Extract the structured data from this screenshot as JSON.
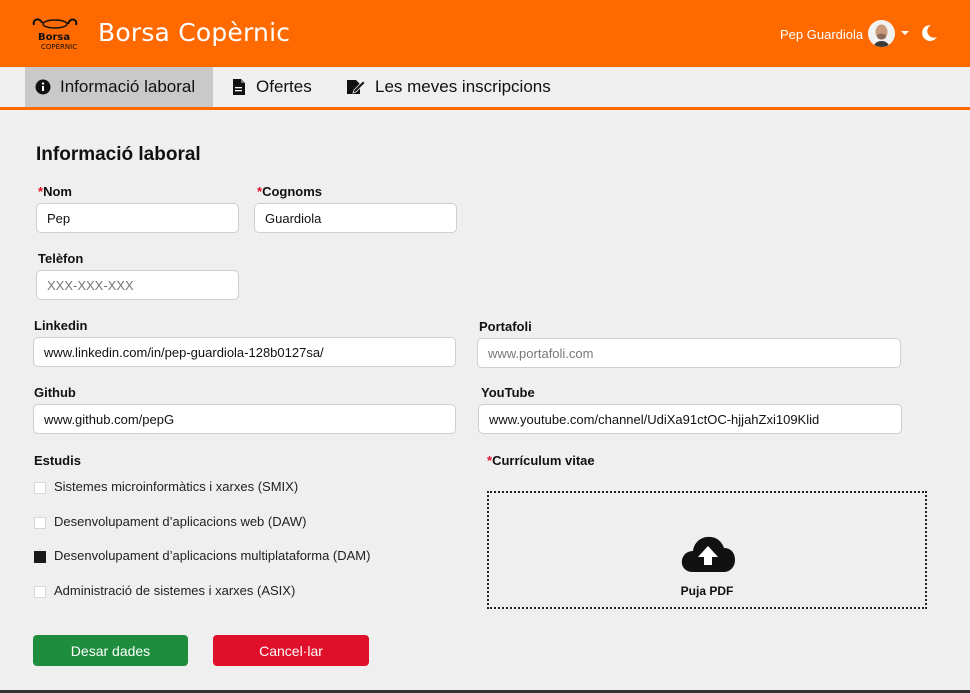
{
  "header": {
    "app_title": "Borsa Copèrnic",
    "logo_text": "Borsa Copèrnic",
    "user_name": "Pep Guardiola",
    "accent_color": "#ff6a00"
  },
  "tabs": [
    {
      "label": "Informació laboral",
      "icon": "info-circle-icon",
      "active": true
    },
    {
      "label": "Ofertes",
      "icon": "document-icon",
      "active": false
    },
    {
      "label": "Les meves inscripcions",
      "icon": "signature-icon",
      "active": false
    }
  ],
  "form": {
    "title": "Informació laboral",
    "nom": {
      "label": "Nom",
      "required_mark": "*",
      "value": "Pep"
    },
    "cognoms": {
      "label": "Cognoms",
      "required_mark": "*",
      "value": "Guardiola"
    },
    "telefon": {
      "label": "Telèfon",
      "placeholder": "XXX-XXX-XXX",
      "value": ""
    },
    "linkedin": {
      "label": "Linkedin",
      "value": "www.linkedin.com/in/pep-guardiola-128b0127sa/"
    },
    "portafoli": {
      "label": "Portafoli",
      "placeholder": "www.portafoli.com",
      "value": ""
    },
    "github": {
      "label": "Github",
      "value": "www.github.com/pepG"
    },
    "youtube": {
      "label": "YouTube",
      "value": "www.youtube.com/channel/UdiXa91ctOC-hjjahZxi109Klid"
    },
    "estudis": {
      "label": "Estudis",
      "options": [
        {
          "label": "Sistemes microinformàtics i xarxes (SMIX)",
          "checked": false
        },
        {
          "label": "Desenvolupament d’aplicacions web (DAW)",
          "checked": false
        },
        {
          "label": "Desenvolupament d’aplicacions multiplataforma (DAM)",
          "checked": true
        },
        {
          "label": "Administració de sistemes i xarxes (ASIX)",
          "checked": false
        }
      ]
    },
    "curriculum": {
      "label": "Currículum vitae",
      "required_mark": "*",
      "upload_label": "Puja PDF"
    }
  },
  "buttons": {
    "save_label": "Desar dades",
    "save_color": "#1e8e3e",
    "cancel_label": "Cancel·lar",
    "cancel_color": "#e0102a"
  }
}
